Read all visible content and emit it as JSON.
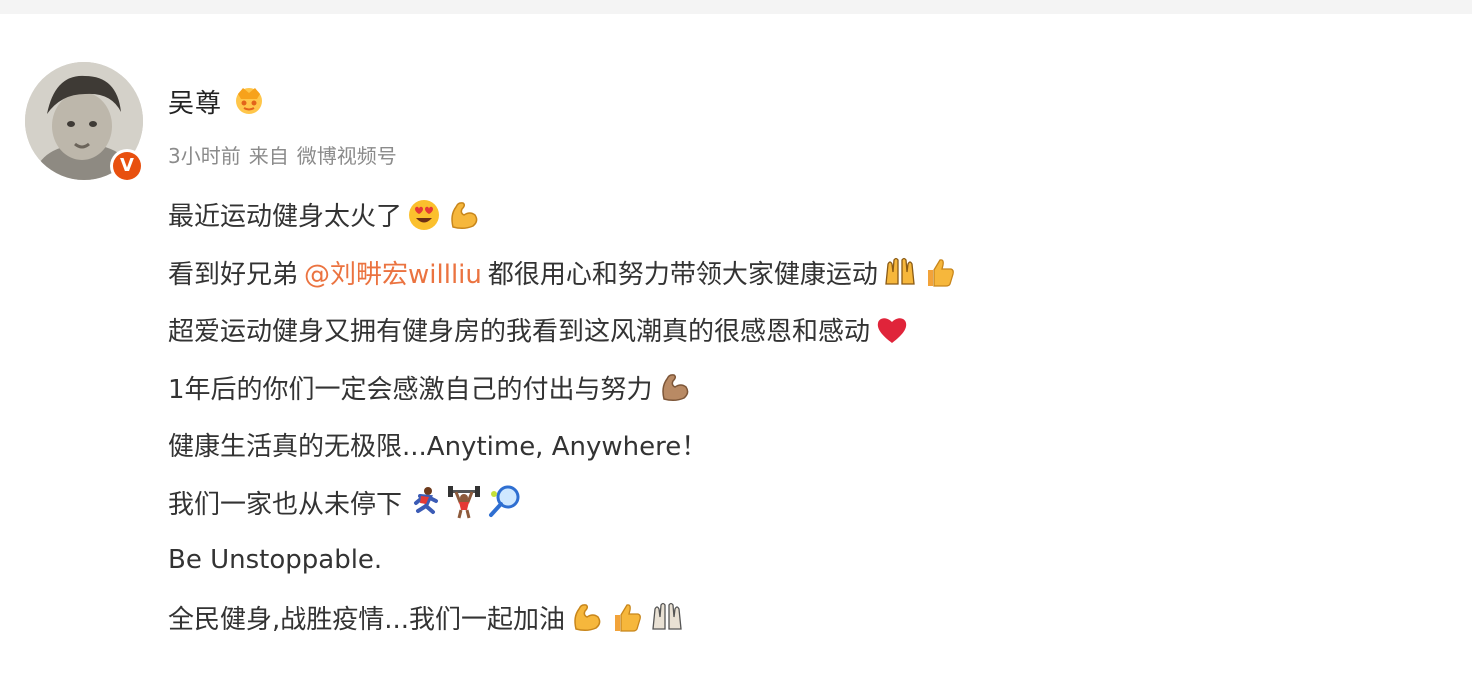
{
  "author": {
    "name": "吴尊",
    "badge_icon": "vip-crown-icon",
    "verified_icon": "verified-v-icon",
    "verified_letter": "V",
    "verified_color": "#e8500f"
  },
  "meta": {
    "time": "3小时前",
    "source_prefix": "来自",
    "source": "微博视频号"
  },
  "post": {
    "mention_color": "#eb7340",
    "line1": {
      "text": "最近运动健身太火了",
      "emojis": [
        "heart-eyes-emoji",
        "flexed-biceps-emoji"
      ]
    },
    "line2": {
      "before": "看到好兄弟",
      "mention": "@刘畊宏willliu",
      "after": "都很用心和努力带领大家健康运动",
      "emojis": [
        "raised-hands-emoji",
        "thumbs-up-emoji"
      ]
    },
    "line3": {
      "text": "超爱运动健身又拥有健身房的我看到这风潮真的很感恩和感动",
      "emojis": [
        "red-heart-emoji"
      ]
    },
    "line4": {
      "text": "1年后的你们一定会感激自己的付出与努力",
      "emojis": [
        "flexed-biceps-tone-emoji"
      ]
    },
    "line5": {
      "text": "健康生活真的无极限...Anytime, Anywhere！"
    },
    "line6": {
      "text": "我们一家也从未停下",
      "emojis": [
        "running-emoji",
        "weightlifting-emoji",
        "tennis-racket-emoji"
      ]
    },
    "line7": {
      "text": "Be Unstoppable."
    },
    "line8": {
      "text": "全民健身,战胜疫情...我们一起加油",
      "emojis": [
        "flexed-biceps-emoji",
        "thumbs-up-emoji",
        "raised-hands-emoji"
      ]
    }
  }
}
